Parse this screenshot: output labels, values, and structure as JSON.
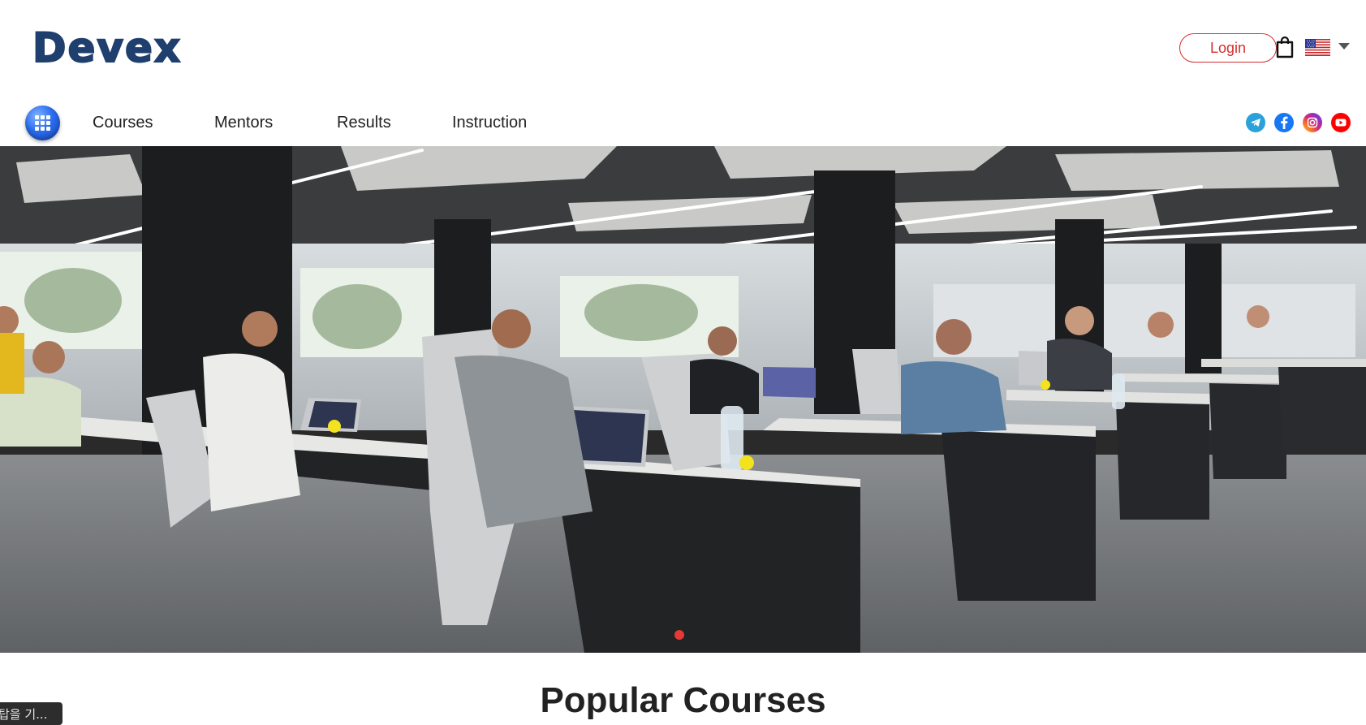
{
  "brand": {
    "logo_text": "Devex"
  },
  "header": {
    "login_label": "Login",
    "cart_icon": "shopping-bag-icon",
    "language_flag": "us-flag-icon"
  },
  "nav": {
    "items": [
      {
        "label": "Courses"
      },
      {
        "label": "Mentors"
      },
      {
        "label": "Results"
      },
      {
        "label": "Instruction"
      }
    ],
    "socials": [
      "telegram-icon",
      "facebook-icon",
      "instagram-icon",
      "youtube-icon"
    ]
  },
  "hero": {
    "image": "open-plan coding classroom with students at laptops",
    "active_slide": 1
  },
  "sections": {
    "popular_title": "Popular Courses"
  },
  "tooltip": {
    "text": "탑을 기..."
  },
  "colors": {
    "brand_navy": "#1f3f6e",
    "accent_red": "#d32f2f",
    "telegram": "#2aa1da",
    "facebook": "#1877f2",
    "youtube": "#ff0000"
  }
}
